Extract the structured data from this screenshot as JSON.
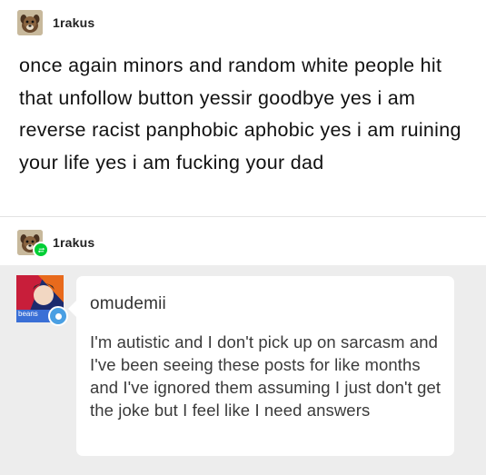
{
  "original_post": {
    "username": "1rakus",
    "avatar_icon": "dog-avatar-icon",
    "text": "once again minors and random white people hit that unfollow button yessir goodbye yes i am reverse racist panphobic aphobic yes i am ruining your life yes i am fucking your dad"
  },
  "reblog": {
    "username": "1rakus",
    "avatar_icon": "dog-avatar-icon",
    "badge_icon": "reblog-icon",
    "badge_color": "#00cf35"
  },
  "ask": {
    "asker_name": "omudemii",
    "avatar_label": "beans",
    "badge_color": "#4a9fe3",
    "text": "I'm autistic and I don't pick up on sarcasm and I've been seeing these posts for like months and I've ignored them assuming I just don't get the joke but I feel like I need answers"
  }
}
